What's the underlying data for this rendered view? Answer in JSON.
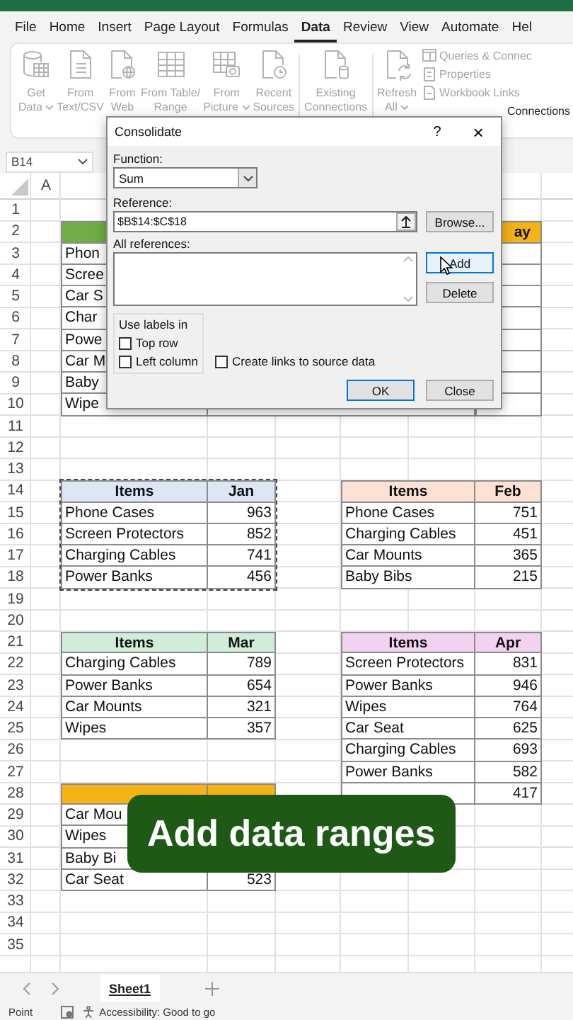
{
  "menu": {
    "tabs": [
      {
        "label": "File",
        "selected": false
      },
      {
        "label": "Home",
        "selected": false
      },
      {
        "label": "Insert",
        "selected": false
      },
      {
        "label": "Page Layout",
        "selected": false
      },
      {
        "label": "Formulas",
        "selected": false
      },
      {
        "label": "Data",
        "selected": true
      },
      {
        "label": "Review",
        "selected": false
      },
      {
        "label": "View",
        "selected": false
      },
      {
        "label": "Automate",
        "selected": false
      },
      {
        "label": "Hel",
        "selected": false
      }
    ]
  },
  "ribbon": {
    "disabled": true,
    "buttons": [
      {
        "kind": "large",
        "lines": [
          "Get",
          "Data"
        ],
        "dropdown": true
      },
      {
        "kind": "large",
        "lines": [
          "From",
          "Text/CSV"
        ],
        "dropdown": false
      },
      {
        "kind": "large",
        "lines": [
          "From",
          "Web"
        ],
        "dropdown": false
      },
      {
        "kind": "large",
        "lines": [
          "From Table/",
          "Range"
        ],
        "dropdown": false
      },
      {
        "kind": "large",
        "lines": [
          "From",
          "Picture"
        ],
        "dropdown": true
      },
      {
        "kind": "large",
        "lines": [
          "Recent",
          "Sources"
        ],
        "dropdown": false
      },
      {
        "kind": "separator"
      },
      {
        "kind": "large",
        "lines": [
          "Existing",
          "Connections"
        ],
        "dropdown": false
      },
      {
        "kind": "separator"
      },
      {
        "kind": "large",
        "lines": [
          "Refresh",
          "All"
        ],
        "dropdown": true
      },
      {
        "kind": "stack",
        "items": [
          "Queries & Connec",
          "Properties",
          "Workbook Links"
        ],
        "group_label": "Connections"
      }
    ]
  },
  "formula_bar": {
    "name_box": "B14"
  },
  "sheet": {
    "column_headers": [
      "A"
    ],
    "row_numbers": [
      "1",
      "2",
      "3",
      "4",
      "5",
      "6",
      "7",
      "8",
      "9",
      "10",
      "11",
      "12",
      "13",
      "14",
      "15",
      "16",
      "17",
      "18",
      "19",
      "20",
      "21",
      "22",
      "23",
      "24",
      "25",
      "26",
      "27",
      "28",
      "29",
      "30",
      "31",
      "32",
      "33",
      "34",
      "35"
    ],
    "tables": [
      {
        "color": "#70ad47",
        "selected": false,
        "rows": [
          [
            "Phon"
          ],
          [
            "Scree"
          ],
          [
            "Car S"
          ],
          [
            "Char"
          ],
          [
            "Powe"
          ],
          [
            "Car M"
          ],
          [
            "Baby"
          ],
          [
            "Wipe"
          ]
        ]
      },
      {
        "color": "#f5b316",
        "selected": false,
        "header": [
          "ay"
        ]
      },
      {
        "color": "#dce6f5",
        "selected": true,
        "header": [
          "Items",
          "Jan"
        ],
        "rows": [
          [
            "Phone Cases",
            "963"
          ],
          [
            "Screen Protectors",
            "852"
          ],
          [
            "Charging Cables",
            "741"
          ],
          [
            "Power Banks",
            "456"
          ]
        ]
      },
      {
        "color": "#fbe2d4",
        "selected": false,
        "header": [
          "Items",
          "Feb"
        ],
        "rows": [
          [
            "Phone Cases",
            "751"
          ],
          [
            "Charging Cables",
            "451"
          ],
          [
            "Car Mounts",
            "365"
          ],
          [
            "Baby Bibs",
            "215"
          ]
        ]
      },
      {
        "color": "#d0eed7",
        "selected": false,
        "header": [
          "Items",
          "Mar"
        ],
        "rows": [
          [
            "Charging Cables",
            "789"
          ],
          [
            "Power Banks",
            "654"
          ],
          [
            "Car Mounts",
            "321"
          ],
          [
            "Wipes",
            "357"
          ]
        ]
      },
      {
        "color": "#f2d2ee",
        "selected": false,
        "header": [
          "Items",
          "Apr"
        ],
        "rows": [
          [
            "Screen Protectors",
            "831"
          ],
          [
            "Power Banks",
            "946"
          ],
          [
            "Wipes",
            "764"
          ],
          [
            "Car Seat",
            "625"
          ],
          [
            "Charging Cables",
            "693"
          ],
          [
            "Power Banks",
            "582"
          ],
          [
            null,
            "417"
          ]
        ]
      },
      {
        "color": "#f5b316",
        "selected": false,
        "rows": [
          [
            "Car Mou"
          ],
          [
            "Wipes"
          ],
          [
            "Baby Bi"
          ],
          [
            "Car Seat",
            "523"
          ]
        ]
      }
    ]
  },
  "dialog": {
    "title": "Consolidate",
    "help": "?",
    "close": "×",
    "function_label": "Function:",
    "function_value": "Sum",
    "reference_label": "Reference:",
    "reference_value": "$B$14:$C$18",
    "all_references_label": "All references:",
    "side_buttons": [
      {
        "label": "Browse...",
        "hovered": false
      },
      {
        "label": "Add",
        "hovered": true
      },
      {
        "label": "Delete",
        "hovered": false
      }
    ],
    "labels_group": "Use labels in",
    "checkboxes": [
      {
        "label": "Top row",
        "checked": false
      },
      {
        "label": "Left column",
        "checked": false
      },
      {
        "label": "Create links to source data",
        "checked": false
      }
    ],
    "bottom_buttons": [
      {
        "label": "OK",
        "default": true
      },
      {
        "label": "Close",
        "default": false
      }
    ]
  },
  "caption": "Add data ranges",
  "sheet_tabs": [
    {
      "label": "Sheet1",
      "selected": true
    }
  ],
  "status_bar": {
    "mode": "Point",
    "accessibility": "Accessibility: Good to go"
  }
}
